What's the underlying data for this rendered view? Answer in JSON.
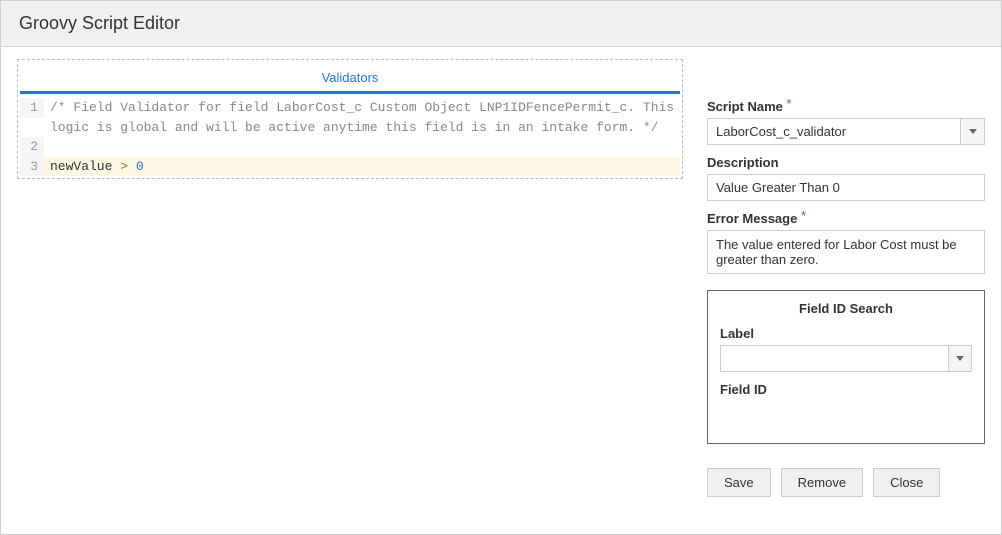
{
  "header": {
    "title": "Groovy Script Editor"
  },
  "tabs": {
    "validators": "Validators"
  },
  "code": {
    "line1": "/* Field Validator for field LaborCost_c Custom Object LNP1IDFencePermit_c. This logic is global and will be active anytime this field is in an intake form. */",
    "line3_id": "newValue",
    "line3_op": ">",
    "line3_num": "0"
  },
  "form": {
    "scriptName": {
      "label": "Script Name",
      "value": "LaborCost_c_validator"
    },
    "description": {
      "label": "Description",
      "value": "Value Greater Than 0"
    },
    "errorMessage": {
      "label": "Error Message",
      "value": "The value entered for Labor Cost must be greater than zero."
    },
    "fieldSearch": {
      "title": "Field ID Search",
      "labelLabel": "Label",
      "labelValue": "",
      "fieldIdLabel": "Field ID",
      "fieldIdValue": ""
    }
  },
  "buttons": {
    "save": "Save",
    "remove": "Remove",
    "close": "Close"
  }
}
